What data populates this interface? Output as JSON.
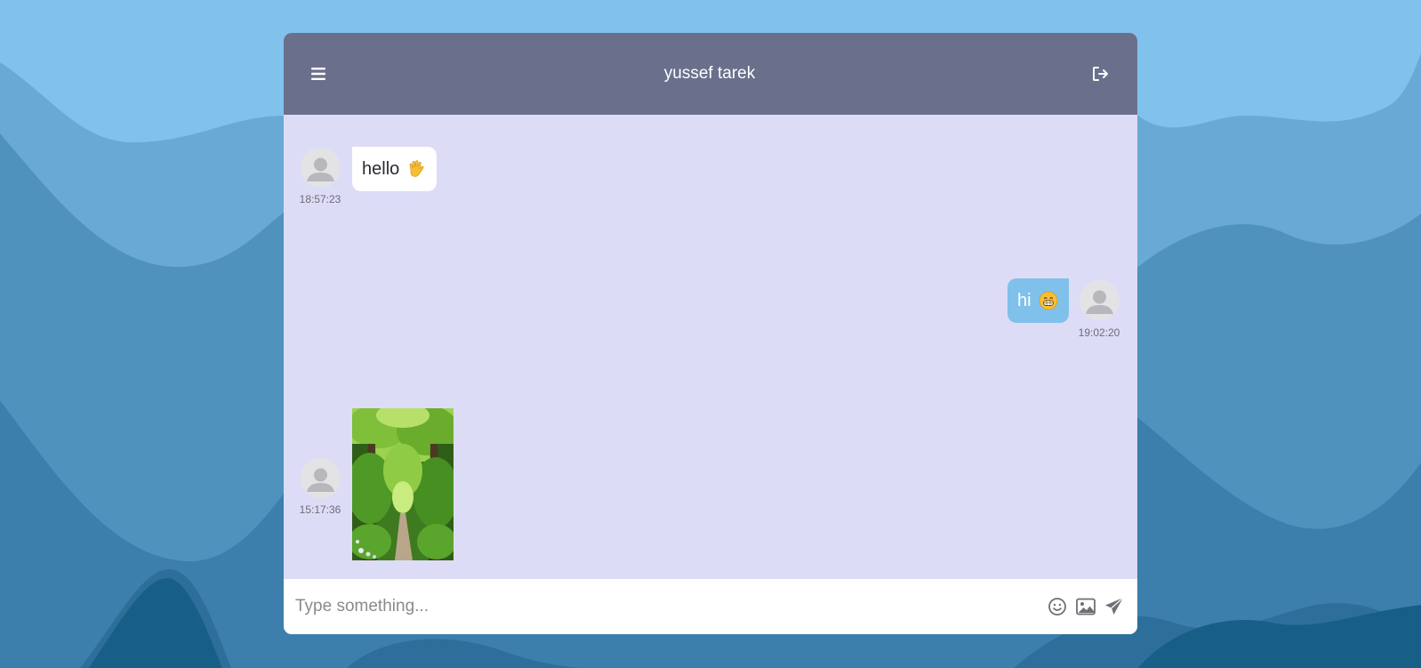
{
  "header": {
    "title": "yussef tarek",
    "menu_icon": "hamburger-menu-icon",
    "logout_icon": "logout-icon"
  },
  "messages": [
    {
      "direction": "received",
      "type": "text",
      "text": "hello",
      "emoji": "raised-hand-emoji",
      "time": "18:57:23"
    },
    {
      "direction": "sent",
      "type": "text",
      "text": "hi",
      "emoji": "grinning-face-emoji",
      "time": "19:02:20"
    },
    {
      "direction": "received",
      "type": "image",
      "image": "forest-path-photo",
      "time": "15:17:36"
    }
  ],
  "composer": {
    "placeholder": "Type something...",
    "value": "",
    "emoji_icon": "smiley-icon",
    "image_icon": "image-upload-icon",
    "send_icon": "send-icon"
  },
  "colors": {
    "header_bg": "#6a708c",
    "chat_bg": "#dddcf7",
    "sent_bubble": "#7fc1ea",
    "received_bubble": "#ffffff",
    "page_bg": "#80c2ec"
  }
}
